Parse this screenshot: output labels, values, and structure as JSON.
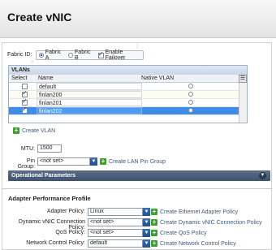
{
  "window": {
    "title": "Create vNIC"
  },
  "fabric": {
    "label": "Fabric ID:",
    "options": [
      {
        "label": "Fabric A",
        "selected": true
      },
      {
        "label": "Fabric B",
        "selected": false
      }
    ],
    "failover": {
      "label": "Enable Failover",
      "checked": true
    }
  },
  "vlans": {
    "header": "VLANs",
    "columns": {
      "select": "Select",
      "name": "Name",
      "native": "Native VLAN"
    },
    "rows": [
      {
        "name": "default",
        "checked": false,
        "native": false
      },
      {
        "name": "finlan200",
        "checked": true,
        "native": false
      },
      {
        "name": "finlan201",
        "checked": true,
        "native": false
      },
      {
        "name": "finlan202",
        "checked": true,
        "native": false
      }
    ]
  },
  "create_vlan": {
    "label": "Create VLAN"
  },
  "mtu": {
    "label": "MTU:",
    "value": "1500"
  },
  "pin_group": {
    "label": "Pin Group:",
    "value": "<not set>",
    "link": "Create LAN Pin Group"
  },
  "operational": {
    "label": "Operational Parameters"
  },
  "adapter": {
    "title": "Adapter Performance Profile",
    "rows": [
      {
        "label": "Adapter Policy:",
        "value": "Linux",
        "link": "Create Ethernet Adapter Policy"
      },
      {
        "label": "Dynamic vNIC Connection Policy:",
        "value": "<not set>",
        "link": "Create Dynamic vNIC Connection Policy"
      },
      {
        "label": "QoS Policy:",
        "value": "<not set>",
        "link": "Create QoS Policy"
      },
      {
        "label": "Network Control Policy:",
        "value": "default",
        "link": "Create Network Control Policy"
      }
    ]
  },
  "colors": {
    "selected_row": "#3e8ee8",
    "accent": "#3b6fb4",
    "header_bar": "#4a5e78"
  }
}
